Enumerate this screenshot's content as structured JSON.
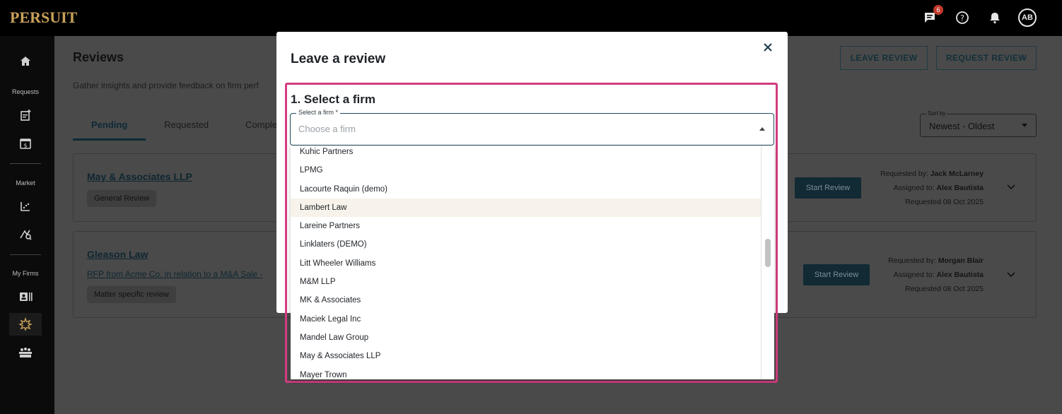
{
  "app": {
    "logo": "PERSUIT",
    "notification_count": "6",
    "avatar_initials": "AB"
  },
  "sidebar": {
    "sections": [
      "Requests",
      "Market",
      "My Firms"
    ],
    "icons": [
      "home-icon",
      "new-request-icon",
      "billing-icon",
      "market-chart-icon",
      "analytics-icon",
      "firm-directory-icon",
      "reviews-icon",
      "panel-icon"
    ]
  },
  "page": {
    "title": "Reviews",
    "subtitle": "Gather insights and provide feedback on firm perf",
    "tabs": [
      {
        "label": "Pending",
        "active": true
      },
      {
        "label": "Requested",
        "active": false
      },
      {
        "label": "Comple",
        "active": false
      }
    ],
    "leave_review_label": "LEAVE REVIEW",
    "request_review_label": "REQUEST REVIEW",
    "sort_label": "Sort by",
    "sort_value": "Newest - Oldest"
  },
  "reviews": [
    {
      "firm": "May & Associates LLP",
      "tag": "General Review",
      "action": "Start Review",
      "requested_by_label": "Requested by:",
      "requested_by": "Jack McLarney",
      "assigned_to_label": "Assigned to:",
      "assigned_to": "Alex Bautista",
      "requested_date": "Requested 08 Oct 2025"
    },
    {
      "firm": "Gleason Law",
      "rfp_link": "RFP from Acme Co. in relation to a M&A Sale -",
      "tag": "Matter specific review",
      "action": "Start Review",
      "requested_by_label": "Requested by:",
      "requested_by": "Morgan Blair",
      "assigned_to_label": "Assigned to:",
      "assigned_to": "Alex Bautista",
      "requested_date": "Requested 08 Oct 2025"
    }
  ],
  "modal": {
    "title": "Leave a review",
    "close_icon": "close-icon",
    "step_title": "1. Select a firm",
    "select_label": "Select a firm *",
    "select_placeholder": "Choose a firm",
    "highlighted_option": "Lambert Law",
    "options": [
      "Kuhic Partners",
      "LPMG",
      "Lacourte Raquin (demo)",
      "Lambert Law",
      "Lareine Partners",
      "Linklaters (DEMO)",
      "Litt Wheeler Williams",
      "M&M LLP",
      "MK & Associates",
      "Maciek Legal Inc",
      "Mandel Law Group",
      "May & Associates LLP",
      "Mayer Trown"
    ]
  },
  "colors": {
    "brand_gold": "#c8a15a",
    "primary_dark": "#112a34",
    "highlight_border": "#d23c80",
    "option_hover": "#f7f3ea"
  }
}
